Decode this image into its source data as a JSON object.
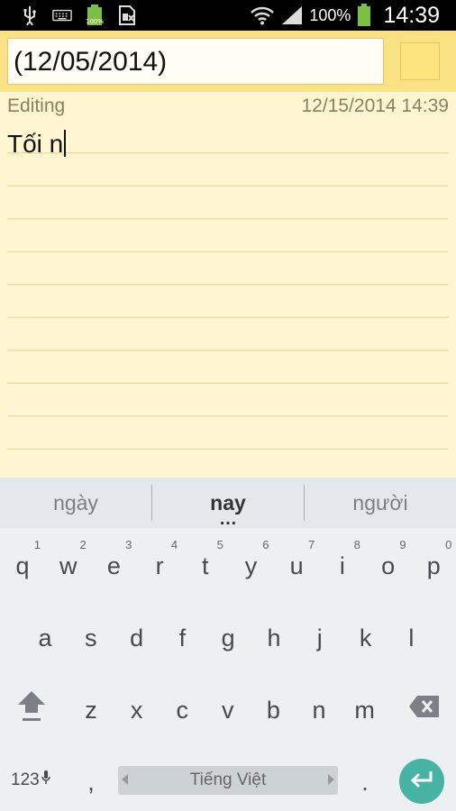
{
  "status_bar": {
    "battery_small_text": "100%",
    "battery_percent": "100%",
    "time": "14:39"
  },
  "title": {
    "value": "(12/05/2014)"
  },
  "note": {
    "mode": "Editing",
    "datetime": "12/15/2014 14:39",
    "text": "Tối n"
  },
  "suggestions": [
    "ngày",
    "nay",
    "người"
  ],
  "keyboard": {
    "row1": [
      {
        "k": "q",
        "n": "1"
      },
      {
        "k": "w",
        "n": "2"
      },
      {
        "k": "e",
        "n": "3"
      },
      {
        "k": "r",
        "n": "4"
      },
      {
        "k": "t",
        "n": "5"
      },
      {
        "k": "y",
        "n": "6"
      },
      {
        "k": "u",
        "n": "7"
      },
      {
        "k": "i",
        "n": "8"
      },
      {
        "k": "o",
        "n": "9"
      },
      {
        "k": "p",
        "n": "0"
      }
    ],
    "row2": [
      "a",
      "s",
      "d",
      "f",
      "g",
      "h",
      "j",
      "k",
      "l"
    ],
    "row3": [
      "z",
      "x",
      "c",
      "v",
      "b",
      "n",
      "m"
    ],
    "symbols_label": "123",
    "comma": ",",
    "space_label": "Tiếng Việt",
    "period": "."
  },
  "colors": {
    "title_bar": "#fae184",
    "note_bg": "#fdf6d0",
    "enter_key": "#46b3a5"
  }
}
